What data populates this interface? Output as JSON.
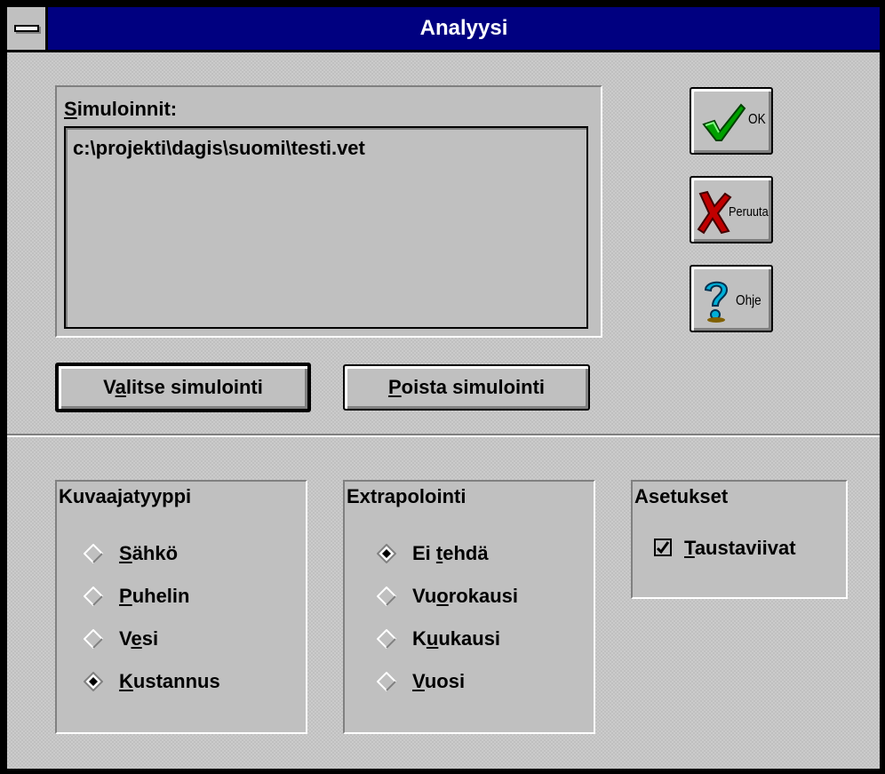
{
  "window": {
    "title": "Analyysi"
  },
  "simulations": {
    "label_pre": "",
    "label_mn": "S",
    "label_post": "imuloinnit:",
    "items": [
      "c:\\projekti\\dagis\\suomi\\testi.vet"
    ]
  },
  "side_buttons": {
    "ok": {
      "label": "OK",
      "icon": "checkmark-icon"
    },
    "cancel": {
      "label": "Peruuta",
      "icon": "red-x-icon"
    },
    "help": {
      "label": "Ohje",
      "icon": "question-mark-icon"
    }
  },
  "buttons": {
    "select": {
      "pre": "V",
      "mn": "a",
      "post": "litse simulointi"
    },
    "remove": {
      "pre": "",
      "mn": "P",
      "post": "oista simulointi"
    }
  },
  "chart_type": {
    "title": "Kuvaajatyyppi",
    "options": [
      {
        "pre": "",
        "mn": "S",
        "post": "ähkö",
        "selected": false
      },
      {
        "pre": "",
        "mn": "P",
        "post": "uhelin",
        "selected": false
      },
      {
        "pre": "V",
        "mn": "e",
        "post": "si",
        "selected": false
      },
      {
        "pre": "",
        "mn": "K",
        "post": "ustannus",
        "selected": true
      }
    ]
  },
  "extrapolation": {
    "title": "Extrapolointi",
    "options": [
      {
        "pre": "Ei ",
        "mn": "t",
        "post": "ehdä",
        "selected": true
      },
      {
        "pre": "Vu",
        "mn": "o",
        "post": "rokausi",
        "selected": false
      },
      {
        "pre": "K",
        "mn": "u",
        "post": "ukausi",
        "selected": false
      },
      {
        "pre": "",
        "mn": "V",
        "post": "uosi",
        "selected": false
      }
    ]
  },
  "settings": {
    "title": "Asetukset",
    "checkbox": {
      "pre": "",
      "mn": "T",
      "post": "austaviivat",
      "checked": true
    }
  },
  "colors": {
    "titlebar": "#000080",
    "face": "#c0c0c0",
    "ok_green": "#00a000",
    "cancel_red": "#c00000",
    "help_blue": "#00a0c8"
  }
}
